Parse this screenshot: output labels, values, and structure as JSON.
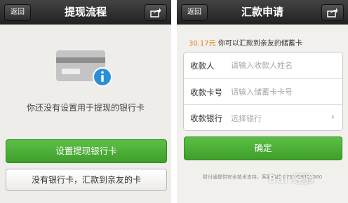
{
  "left_screen": {
    "back_label": "返回",
    "title": "提现流程",
    "message": "你还没有设置用于提现的银行卡",
    "primary_button": "设置提现银行卡",
    "secondary_button": "没有银行卡，汇款到亲友的卡"
  },
  "right_screen": {
    "back_label": "返回",
    "title": "汇款申请",
    "amount_value": "30.17元",
    "amount_text": " 你可以汇款到亲友的储蓄卡",
    "rows": [
      {
        "label": "收款人",
        "placeholder": "请输入收款人姓名"
      },
      {
        "label": "收款卡号",
        "placeholder": "请输入储蓄卡卡号"
      },
      {
        "label": "收款银行",
        "value": "选择银行"
      }
    ],
    "confirm_button": "确定",
    "footer": "财付通提供安全技术支持，客服热线 0755-86013860",
    "watermark": "Bai 经验"
  },
  "icons": {
    "share": "share-icon",
    "card": "bank-card-icon",
    "info": "info-icon",
    "chevron": "chevron-right-icon"
  },
  "colors": {
    "nav_bar": "#2b2b2b",
    "primary_green": "#4cae36",
    "amount_orange": "#e07b12",
    "info_blue": "#2b8fd8"
  }
}
